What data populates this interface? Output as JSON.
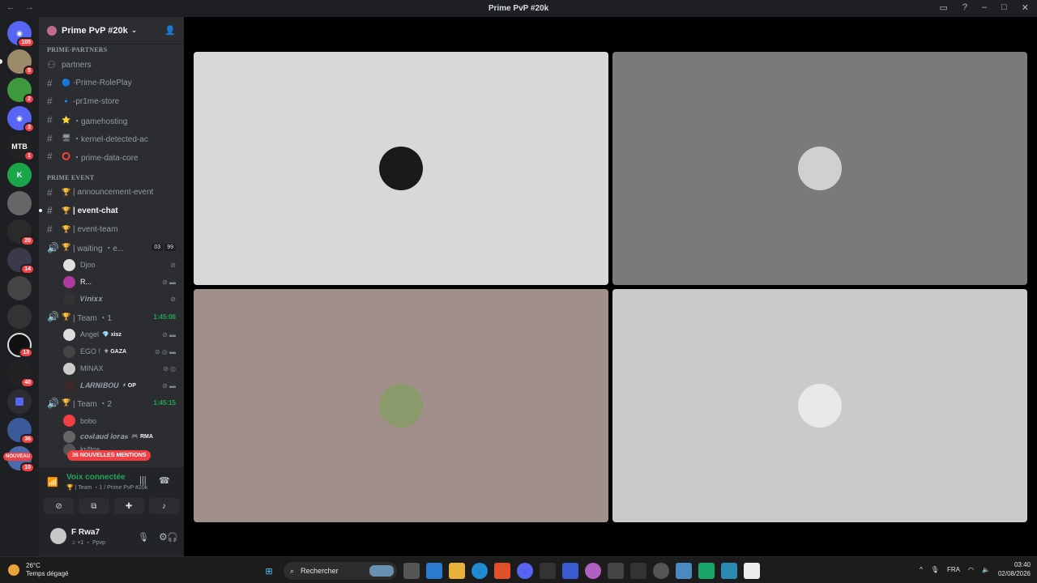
{
  "window": {
    "title": "Prime PvP #20k",
    "nav_back": "←",
    "nav_fwd": "→"
  },
  "guilds": {
    "badges": [
      "105",
      "5",
      "2",
      "3",
      "1",
      "",
      "",
      "20",
      "14",
      "",
      "",
      "13",
      "40",
      "",
      "36",
      "10"
    ],
    "nouveau": "NOUVEAU"
  },
  "server": {
    "name": "Prime PvP #20k"
  },
  "categories": {
    "partners": "PRIME-PARTNERS",
    "event": "PRIME EVENT"
  },
  "channels": [
    {
      "name": "partners",
      "emoji": ""
    },
    {
      "name": "-Prime-RolePlay",
      "emoji": "🔵"
    },
    {
      "name": "-pr1me-store",
      "emoji": "🔹"
    },
    {
      "name": "・gamehosting",
      "emoji": "⭐"
    },
    {
      "name": "・kernel-detected-ac",
      "emoji": "🖥"
    },
    {
      "name": "・prime-data-core",
      "emoji": "⭕"
    }
  ],
  "event_channels": [
    {
      "name": "| announcement-event"
    },
    {
      "name": "| event-chat"
    },
    {
      "name": "| event-team"
    }
  ],
  "waiting": {
    "name": "| waiting ・e...",
    "count1": "03",
    "count2": "99"
  },
  "waiting_users": [
    "Djoo",
    "R...",
    "𝑽𝒊𝒏𝒊𝒙𝒙"
  ],
  "team1": {
    "name": "| Team ・1",
    "timer": "1:45:06"
  },
  "team1_users": [
    {
      "name": "Angel",
      "tag": "💎 xisz"
    },
    {
      "name": "EGO !",
      "tag": "⚜ GAZA"
    },
    {
      "name": "MINAX",
      "tag": ""
    },
    {
      "name": "𝑳𝑨𝑹𝑵𝑰𝑩𝑶𝑼",
      "tag": "⚡ OP"
    }
  ],
  "team2": {
    "name": "| Team ・2",
    "timer": "1:45:15"
  },
  "team2_users": [
    {
      "name": "bobo",
      "tag": ""
    },
    {
      "name": "𝒄𝒐𝒔𝒕𝒂𝒖𝒅 𝒍𝒐𝒓𝒂𝒔",
      "tag": "🎮 RMA"
    },
    {
      "name": "kr4tos",
      "tag": ""
    }
  ],
  "mentions": "36 NOUVELLES MENTIONS",
  "voice": {
    "status": "Voix connectée",
    "sub": "🏆 | Team ・1 / Prime PvP #20k"
  },
  "user": {
    "name": "F Rwa7",
    "status": "♫ +1 ・ Ppvp"
  },
  "tiles": [
    {
      "bg": "#d8d8d8",
      "avatar": "#1a1a1a"
    },
    {
      "bg": "#7a7a7a",
      "avatar": "#d0d0d0"
    },
    {
      "bg": "#a18f8b",
      "avatar": "#8a9a6a"
    },
    {
      "bg": "#cacaca",
      "avatar": "#e8e8e8"
    }
  ],
  "taskbar": {
    "temp": "26°C",
    "weather": "Temps dégagé",
    "search": "Rechercher",
    "lang": "FRA",
    "time": "03:40",
    "date": "02/08/2026"
  }
}
